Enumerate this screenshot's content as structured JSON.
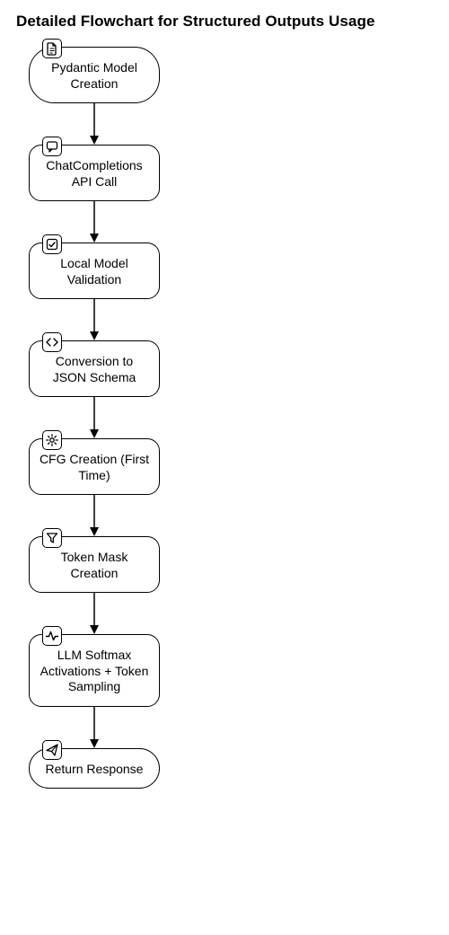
{
  "title": "Detailed Flowchart for Structured Outputs Usage",
  "nodes": [
    {
      "label": "Pydantic Model Creation",
      "icon": "file-icon",
      "terminal": true
    },
    {
      "label": "ChatCompletions API Call",
      "icon": "chat-icon",
      "terminal": false
    },
    {
      "label": "Local Model Validation",
      "icon": "check-icon",
      "terminal": false
    },
    {
      "label": "Conversion to JSON Schema",
      "icon": "code-icon",
      "terminal": false
    },
    {
      "label": "CFG Creation (First Time)",
      "icon": "gear-icon",
      "terminal": false
    },
    {
      "label": "Token Mask Creation",
      "icon": "filter-icon",
      "terminal": false
    },
    {
      "label": "LLM Softmax Activations + Token Sampling",
      "icon": "activity-icon",
      "terminal": false
    },
    {
      "label": "Return Response",
      "icon": "send-icon",
      "terminal": true
    }
  ]
}
